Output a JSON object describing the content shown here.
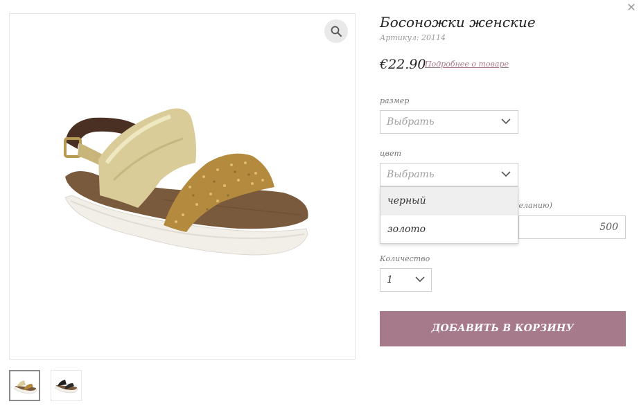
{
  "modal": {
    "close_icon": "close-icon"
  },
  "gallery": {
    "main_image_alt": "gold-glitter-sandal",
    "zoom_icon": "magnifier-icon",
    "thumbnails": [
      {
        "name": "gold-sandal",
        "active": true
      },
      {
        "name": "black-sandal",
        "active": false
      }
    ]
  },
  "product": {
    "title": "Босоножки женские",
    "sku": "Артикул: 20114",
    "price": "€22.90",
    "more_link": "Подробнее о товаре"
  },
  "options": {
    "size": {
      "label": "размер",
      "placeholder": "Выбрать"
    },
    "color": {
      "label": "цвет",
      "placeholder": "Выбрать",
      "options": [
        "черный",
        "золото"
      ],
      "hovered": "черный"
    },
    "donation": {
      "label_visible_fragment": "желанию)",
      "value": "500"
    },
    "quantity": {
      "label": "Количество",
      "value": "1"
    }
  },
  "cart": {
    "add_label": "Добавить в корзину"
  },
  "colors": {
    "accent": "#a77a8b",
    "border": "#cfcfcf",
    "muted_text": "#a0a0a0"
  }
}
